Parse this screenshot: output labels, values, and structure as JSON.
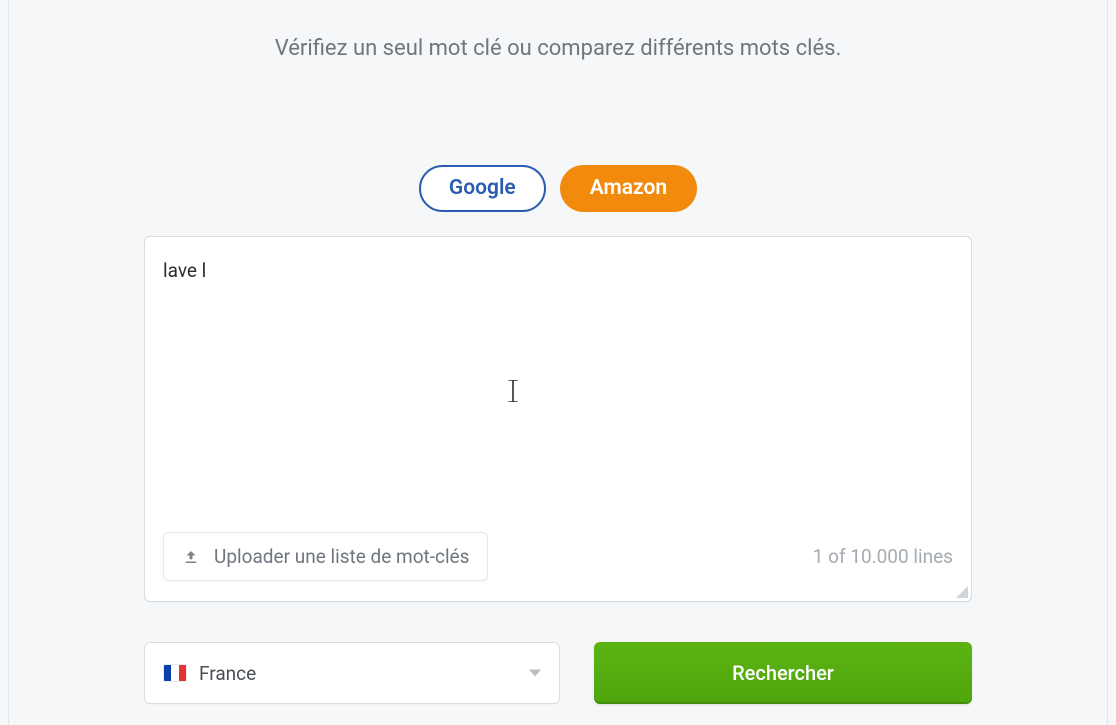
{
  "header": {
    "instruction": "Vérifiez un seul mot clé ou comparez différents mots clés."
  },
  "tabs": {
    "google": "Google",
    "amazon": "Amazon"
  },
  "input": {
    "value": "lave l",
    "upload_label": "Uploader une liste de mot-clés",
    "lines_status": "1 of 10.000 lines"
  },
  "country": {
    "selected": "France"
  },
  "actions": {
    "search": "Rechercher"
  }
}
